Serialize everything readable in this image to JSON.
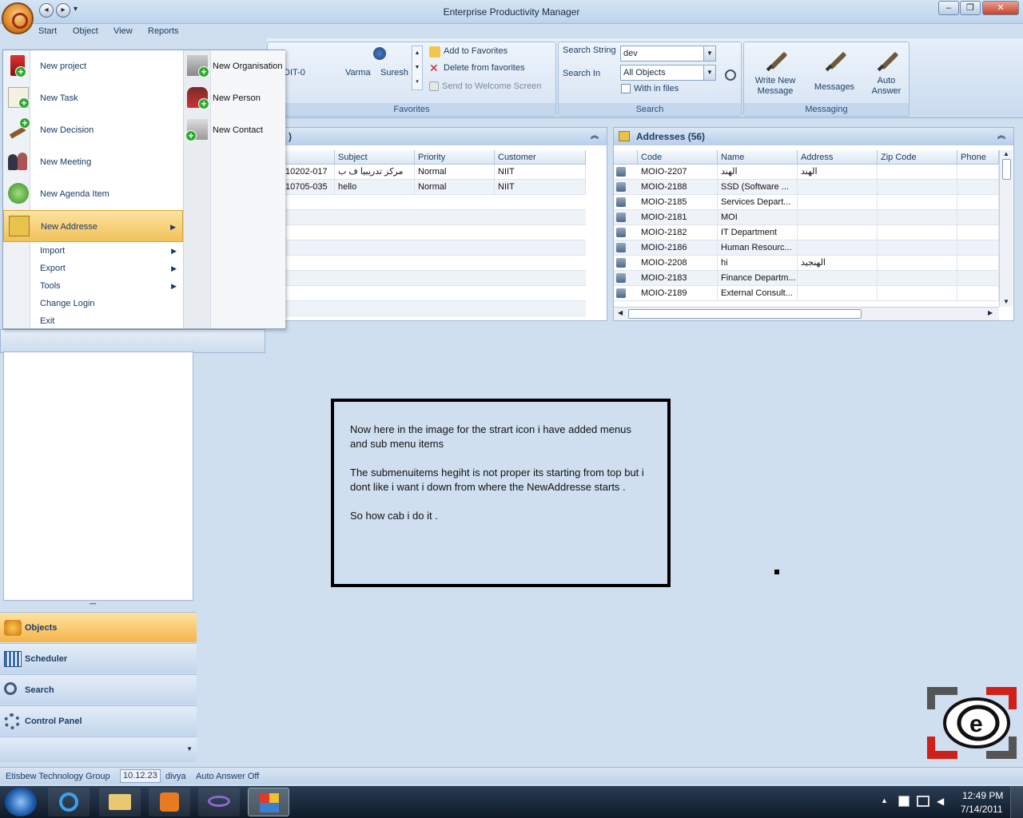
{
  "window": {
    "title": "Enterprise Productivity Manager",
    "qat_dropdown": "▾"
  },
  "menu_tabs": [
    "Start",
    "Object",
    "View",
    "Reports"
  ],
  "ribbon": {
    "favorites": {
      "label": "Favorites",
      "add": "Add to Favorites",
      "delete": "Delete from favorites",
      "send": "Send to Welcome Screen",
      "items": [
        "DIT-0",
        "Varma",
        "Suresh"
      ]
    },
    "search": {
      "label": "Search",
      "string_label": "Search String",
      "string_value": "dev",
      "in_label": "Search In",
      "in_value": "All Objects",
      "with_files": "With in files"
    },
    "messaging": {
      "label": "Messaging",
      "write": "Write New Message",
      "messages": "Messages",
      "auto": "Auto Answer"
    }
  },
  "start_menu": {
    "items": [
      "New project",
      "New Task",
      "New Decision",
      "New Meeting",
      "New Agenda Item",
      "New Addresse"
    ],
    "small_items": [
      "Import",
      "Export",
      "Tools",
      "Change Login",
      "Exit"
    ],
    "submenu": [
      "New Organisation",
      "New Person",
      "New Contact"
    ]
  },
  "left_grid": {
    "title_suffix": ")",
    "columns": [
      "Subject",
      "Priority",
      "Customer"
    ],
    "rows": [
      [
        "10202-017",
        "مركز تدريبيا ف ب",
        "Normal",
        "NIIT"
      ],
      [
        "10705-035",
        "hello",
        "Normal",
        "NIIT"
      ]
    ]
  },
  "addresses": {
    "title": "Addresses (56)",
    "columns": [
      "Code",
      "Name",
      "Address",
      "Zip Code",
      "Phone"
    ],
    "rows": [
      [
        "MOIO-2207",
        "الهند",
        "الهند"
      ],
      [
        "MOIO-2188",
        "SSD (Software ...",
        ""
      ],
      [
        "MOIO-2185",
        "Services Depart...",
        ""
      ],
      [
        "MOIO-2181",
        "MOI",
        ""
      ],
      [
        "MOIO-2182",
        "IT Department",
        ""
      ],
      [
        "MOIO-2186",
        "Human Resourc...",
        ""
      ],
      [
        "MOIO-2208",
        "hi",
        "الهنجيد"
      ],
      [
        "MOIO-2183",
        "Finance Departm...",
        ""
      ],
      [
        "MOIO-2189",
        "External Consult...",
        ""
      ]
    ]
  },
  "nav": {
    "grip": "••••",
    "buttons": [
      "Objects",
      "Scheduler",
      "Search",
      "Control Panel"
    ]
  },
  "note": [
    "Now here in the image for the strart icon i have added menus and sub menu items",
    "The submenuitems hegiht is not proper its starting from top but i dont like i want i down from where the NewAddresse starts .",
    "So how cab i do it ."
  ],
  "status": {
    "company": "Etisbew Technology Group",
    "version": "10.12.23",
    "user": "divya",
    "auto": "Auto Answer Off"
  },
  "clock": {
    "time": "12:49 PM",
    "date": "7/14/2011"
  }
}
